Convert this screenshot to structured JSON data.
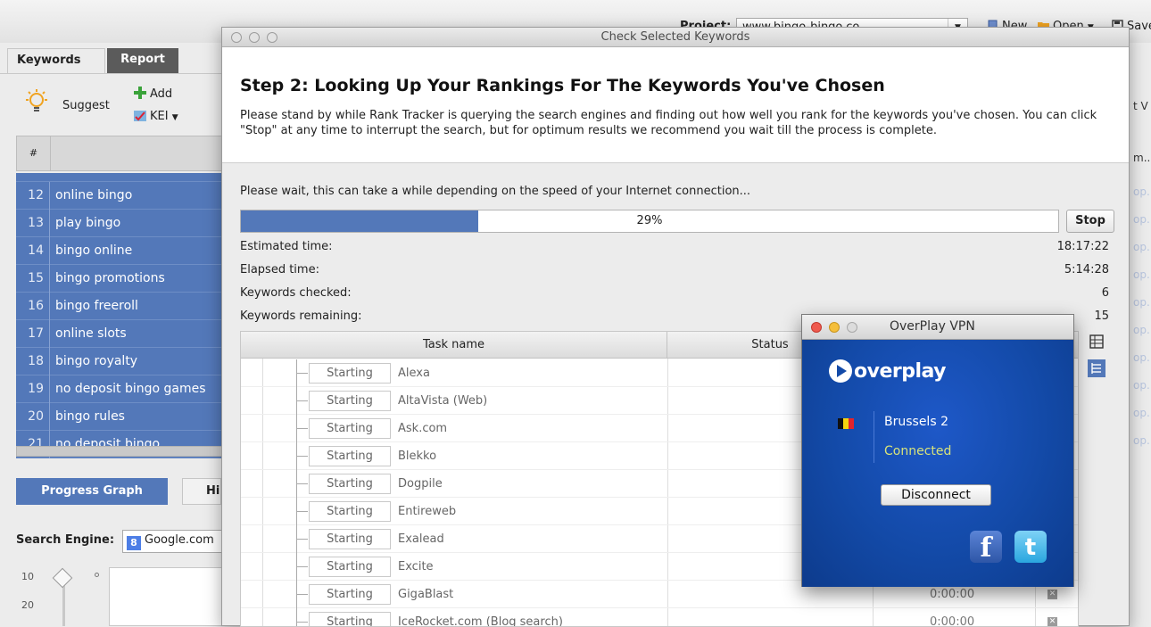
{
  "topbar": {
    "project_label": "Project:",
    "project_value": "www.bingo-bingo.co",
    "new_label": "New",
    "open_label": "Open",
    "save_label": "Save"
  },
  "tabs": [
    {
      "label": "Keywords",
      "active": true
    },
    {
      "label": "Report",
      "active": false
    }
  ],
  "toolbar": {
    "suggest_label": "Suggest",
    "add_label": "Add",
    "kei_label": "KEI"
  },
  "grid": {
    "hash_header": "#",
    "keywords": [
      {
        "num": "12",
        "text": "online bingo"
      },
      {
        "num": "13",
        "text": "play bingo"
      },
      {
        "num": "14",
        "text": "bingo online"
      },
      {
        "num": "15",
        "text": "bingo promotions"
      },
      {
        "num": "16",
        "text": "bingo freeroll"
      },
      {
        "num": "17",
        "text": "online slots"
      },
      {
        "num": "18",
        "text": "bingo royalty"
      },
      {
        "num": "19",
        "text": "no deposit bingo games"
      },
      {
        "num": "20",
        "text": "bingo rules"
      },
      {
        "num": "21",
        "text": "no deposit bingo"
      }
    ]
  },
  "bottom": {
    "progress_graph_label": "Progress Graph",
    "history_tab_label": "His",
    "search_engine_label": "Search Engine:",
    "search_engine_value": "Google.com",
    "axis_values": [
      "10",
      "20"
    ]
  },
  "right_strip": {
    "column_header_1": "t V",
    "column_header_2": "m..",
    "cell_text": "op..."
  },
  "dialog": {
    "title": "Check Selected Keywords",
    "heading": "Step 2: Looking Up Your Rankings For The Keywords You've Chosen",
    "description": "Please stand by while Rank Tracker is querying the search engines and finding out how well you rank for the keywords you've chosen. You can click \"Stop\" at any time to interrupt the search, but for optimum results we recommend you wait till the process is complete.",
    "wait_text": "Please wait, this can take a while depending on the speed of your Internet connection...",
    "progress_percent": 29,
    "progress_label": "29%",
    "stop_label": "Stop",
    "stats": [
      {
        "label": "Estimated time:",
        "value": "18:17:22"
      },
      {
        "label": "Elapsed time:",
        "value": "5:14:28"
      },
      {
        "label": "Keywords checked:",
        "value": "6"
      },
      {
        "label": "Keywords remaining:",
        "value": "15"
      }
    ],
    "task_table": {
      "columns": [
        "Task name",
        "Status"
      ],
      "rows": [
        {
          "state": "Starting",
          "name": "Alexa",
          "time": ""
        },
        {
          "state": "Starting",
          "name": "AltaVista (Web)",
          "time": ""
        },
        {
          "state": "Starting",
          "name": "Ask.com",
          "time": ""
        },
        {
          "state": "Starting",
          "name": "Blekko",
          "time": ""
        },
        {
          "state": "Starting",
          "name": "Dogpile",
          "time": ""
        },
        {
          "state": "Starting",
          "name": "Entireweb",
          "time": ""
        },
        {
          "state": "Starting",
          "name": "Exalead",
          "time": ""
        },
        {
          "state": "Starting",
          "name": "Excite",
          "time": ""
        },
        {
          "state": "Starting",
          "name": "GigaBlast",
          "time": "0:00:00"
        },
        {
          "state": "Starting",
          "name": "IceRocket.com (Blog search)",
          "time": "0:00:00"
        }
      ]
    }
  },
  "vpn": {
    "title": "OverPlay VPN",
    "logo_text": "overplay",
    "server": "Brussels 2",
    "status": "Connected",
    "disconnect_label": "Disconnect",
    "status_color": "#d8e37a",
    "brand_blue": "#134aa8",
    "facebook_glyph": "f",
    "twitter_glyph": "t"
  },
  "colors": {
    "selection_blue": "#5378b9",
    "dialog_bg": "#ececec"
  }
}
